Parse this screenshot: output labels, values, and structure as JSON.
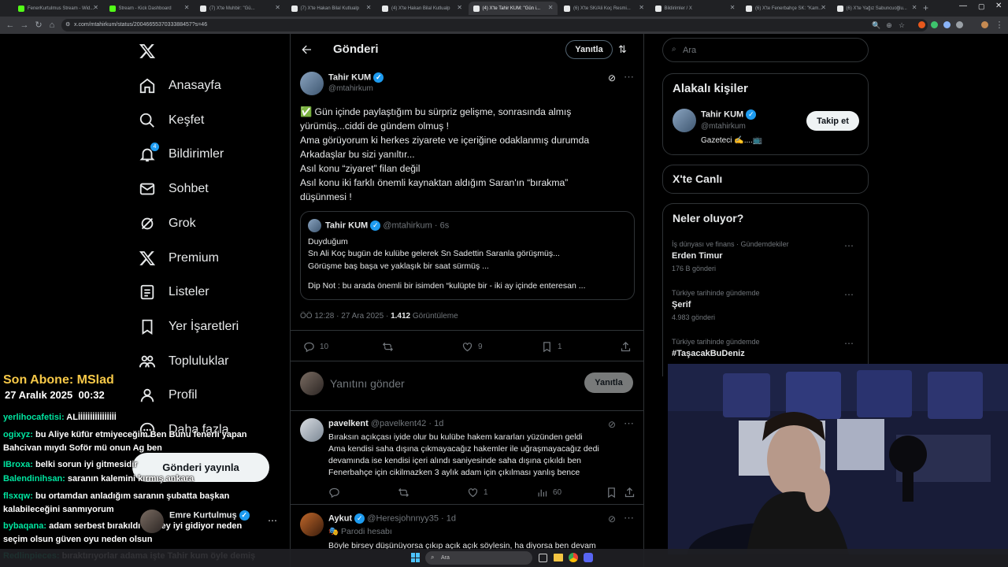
{
  "browser": {
    "tabs": [
      {
        "title": "FenerKurtulmus Stream - Wid...",
        "color": "#53fc18"
      },
      {
        "title": "Stream - Kick Dashboard",
        "color": "#53fc18"
      },
      {
        "title": "(7) X'te Muhbir: \"Gü...",
        "color": "#e7e9ea"
      },
      {
        "title": "(7) X'te Hakan Bilal Kutlualp",
        "color": "#e7e9ea"
      },
      {
        "title": "(4) X'te Hakan Bilal Kutlualp",
        "color": "#e7e9ea"
      },
      {
        "title": "(4) X'te Tahir KUM: \"Gün i...",
        "color": "#e7e9ea"
      },
      {
        "title": "(6) X'te SK/Ali Koç Resmi...",
        "color": "#e7e9ea"
      },
      {
        "title": "Bildirimler / X",
        "color": "#e7e9ea"
      },
      {
        "title": "(6) X'te Fenerbahçe SK: \"Kam...",
        "color": "#e7e9ea"
      },
      {
        "title": "(6) X'te Yağız Sabuncuoğlu...",
        "color": "#e7e9ea"
      }
    ],
    "active_tab": 5,
    "url": "x.com/mtahirkum/status/2004665537033388457?s=46"
  },
  "nav": {
    "items": [
      {
        "label": "Anasayfa",
        "icon": "home-icon"
      },
      {
        "label": "Keşfet",
        "icon": "search-icon"
      },
      {
        "label": "Bildirimler",
        "icon": "bell-icon",
        "badge": "4"
      },
      {
        "label": "Sohbet",
        "icon": "mail-icon"
      },
      {
        "label": "Grok",
        "icon": "grok-icon"
      },
      {
        "label": "Premium",
        "icon": "x-logo-icon"
      },
      {
        "label": "Listeler",
        "icon": "list-icon"
      },
      {
        "label": "Yer İşaretleri",
        "icon": "bookmark-icon"
      },
      {
        "label": "Topluluklar",
        "icon": "communities-icon"
      },
      {
        "label": "Profil",
        "icon": "profile-icon"
      },
      {
        "label": "Daha fazla",
        "icon": "more-icon"
      }
    ],
    "post_button": "Gönderi yayınla",
    "account": {
      "name": "Emre Kurtulmuş",
      "handle": "@"
    }
  },
  "header": {
    "title": "Gönderi",
    "reply_button": "Yanıtla"
  },
  "post": {
    "author": "Tahir KUM",
    "handle": "@mtahirkum",
    "lines": [
      "✅ Gün içinde paylaştığım bu sürpriz gelişme, sonrasında almış",
      "yürümüş...ciddi de gündem olmuş !",
      "Ama görüyorum ki herkes ziyarete ve içeriğine odaklanmış durumda",
      "Arkadaşlar bu sizi yanıltır...",
      "Asıl konu “ziyaret” filan değil",
      "Asıl konu iki farklı önemli kaynaktan aldığım Saran'ın “bırakma”",
      "düşünmesi !"
    ],
    "quote": {
      "author": "Tahir KUM",
      "handle": "@mtahirkum",
      "time": "· 6s",
      "lines": [
        "Duyduğum",
        "Sn Ali Koç bugün de kulübe gelerek Sn Sadettin Saranla görüşmüş...",
        "Görüşme baş başa ve yaklaşık bir saat sürmüş ...",
        "",
        "Dip Not : bu arada önemli bir isimden “kulüpte bir - iki ay içinde enteresan ..."
      ]
    },
    "timestamp": "ÖÖ 12:28 · 27 Ara 2025 · ",
    "views": "1.412",
    "views_label": "Görüntüleme",
    "replies": "10",
    "retweets": "",
    "likes": "9",
    "bookmarks": "1"
  },
  "reply_box": {
    "placeholder": "Yanıtını gönder",
    "button": "Yanıtla"
  },
  "replies": [
    {
      "author": "pavelkent",
      "handle": "@pavelkent42",
      "time": "· 1d",
      "verified": false,
      "lines": [
        "Bıraksın açıkçası iyide olur bu kulübe hakem kararları yüzünden geldi",
        "Ama kendisi saha dışına çıkmayacağız hakemler ile uğraşmayacağız dedi",
        "devamında ise kendisi içeri alındı saniyesinde saha dışına çıkıldı ben",
        "Fenerbahçe için cikilmazken 3 aylık adam için çıkılması yanlış bence"
      ],
      "likes": "1",
      "views": "60"
    },
    {
      "author": "Aykut",
      "handle": "@Heresjohnnyy35",
      "time": "· 1d",
      "verified": true,
      "parody": "Parodi hesabı",
      "lines": [
        "Böyle birsey düşünüyorsa çıkıp açık açık söylesin, ha diyorsa ben devam"
      ]
    }
  ],
  "right": {
    "search_placeholder": "Ara",
    "related_title": "Alakalı kişiler",
    "related_person": {
      "name": "Tahir KUM",
      "handle": "@mtahirkum",
      "bio": "Gazeteci ✍️....📺",
      "follow": "Takip et"
    },
    "live_title": "X'te Canlı",
    "trends_title": "Neler oluyor?",
    "trends": [
      {
        "category": "İş dünyası ve finans · Gündemdekiler",
        "name": "Erden Timur",
        "count": "176 B gönderi"
      },
      {
        "category": "Türkiye tarihinde gündemde",
        "name": "Şerif",
        "count": "4.983 gönderi"
      },
      {
        "category": "Türkiye tarihinde gündemde",
        "name": "#TaşacakBuDeniz",
        "count": ""
      }
    ]
  },
  "overlay": {
    "last_sub": "Son Abone: MSlad",
    "date": "27 Aralık 2025",
    "time": "00:32",
    "chat": [
      {
        "user": "yerlihocafetisi:",
        "msg": "ALİİİİİİİİİİİİİİİİ"
      },
      {
        "user": "ogixyz:",
        "msg": "bu Aliye küfür etmiyeceğim Ben Bunu fenerli yapan Bahcivan mıydı Soför mü onun Ag ben"
      },
      {
        "user": "IBroxa:",
        "msg": "belki sorun iyi gitmesidir"
      },
      {
        "user": "Balendinihsan:",
        "msg": "saranın kalemini kırmış ankara"
      },
      {
        "user": "flsxqw:",
        "msg": "bu ortamdan anladığım saranın şubatta başkan kalabileceğini sanmıyorum"
      },
      {
        "user": "bybaqana:",
        "msg": "adam serbest bırakıldı herşey iyi gidiyor neden seçim olsun güven oyu neden olsun"
      },
      {
        "user": "Redlinpieces:",
        "msg": "bıraktırıyorlar adama işte Tahir kum öyle demiş"
      }
    ]
  },
  "taskbar": {
    "search": "Ara"
  },
  "colors": {
    "accent": "#1d9bf0",
    "chat_user": "#00e5a0",
    "sub": "#f7c948"
  }
}
